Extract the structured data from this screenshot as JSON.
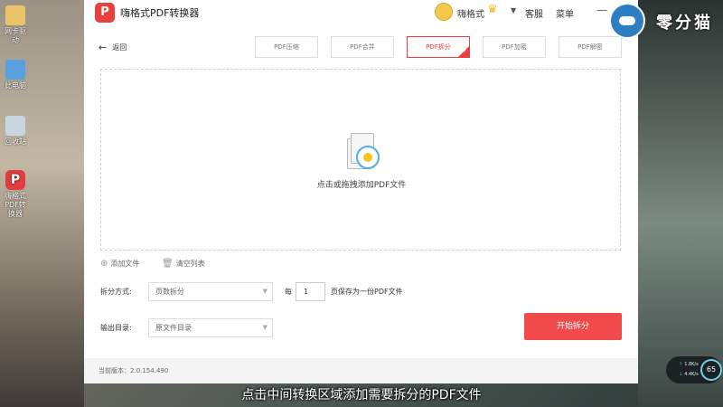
{
  "desktop": {
    "icons": [
      {
        "label": "网卡驱动",
        "icon": "folder-icon"
      },
      {
        "label": "此电脑",
        "icon": "computer-icon"
      },
      {
        "label": "回收站",
        "icon": "recycle-bin-icon"
      },
      {
        "label": "嗨格式PDF转换器",
        "icon": "app-icon"
      }
    ]
  },
  "window": {
    "title": "嗨格式PDF转换器",
    "logo_glyph": "P",
    "user": {
      "name": "嗨格式"
    },
    "header_links": {
      "service": "客服",
      "menu": "菜单"
    },
    "back_label": "返回",
    "tabs": [
      {
        "label": "PDF压缩",
        "active": false
      },
      {
        "label": "PDF合并",
        "active": false
      },
      {
        "label": "PDF拆分",
        "active": true
      },
      {
        "label": "PDF加密",
        "active": false
      },
      {
        "label": "PDF解密",
        "active": false
      }
    ],
    "drop_hint": "点击或拖拽添加PDF文件",
    "actions": {
      "add_file": "添加文件",
      "clear_list": "清空列表"
    },
    "split": {
      "label": "拆分方式:",
      "mode": "页数拆分",
      "per_prefix": "每",
      "pages": "1",
      "per_suffix": "页保存为一份PDF文件"
    },
    "output": {
      "label": "输出目录:",
      "value": "原文件目录"
    },
    "start_button": "开始拆分",
    "version": "当前版本：2.0.154.490"
  },
  "watermark": {
    "text": "零分猫"
  },
  "net_widget": {
    "up": "1.8",
    "down": "4.4",
    "unit": "K/s",
    "percent": "65"
  },
  "subtitle": "点击中间转换区域添加需要拆分的PDF文件",
  "colors": {
    "accent": "#e8403f",
    "button": "#f04a4a"
  }
}
